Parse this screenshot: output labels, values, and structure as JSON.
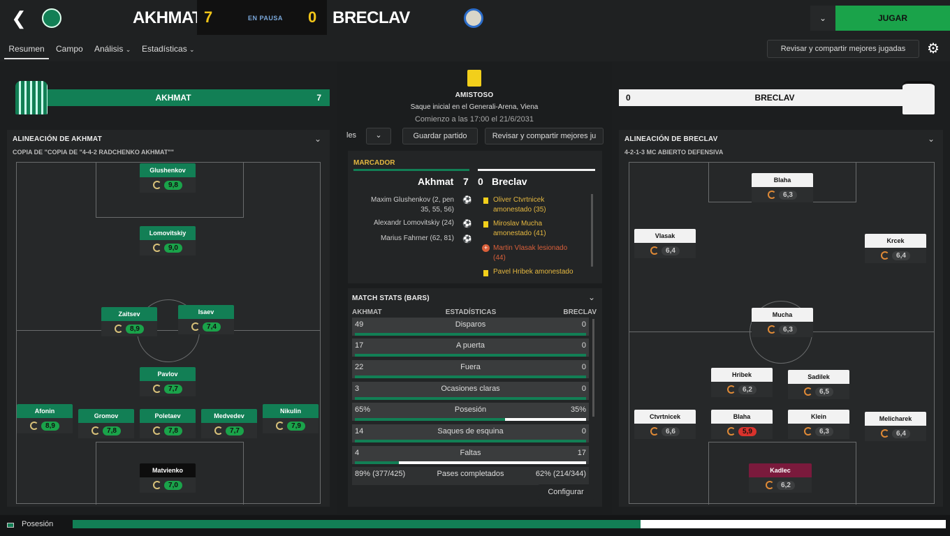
{
  "header": {
    "home_team": "AKHMAT",
    "home_score": "7",
    "status": "EN PAUSA",
    "away_score": "0",
    "away_team": "BRECLAV",
    "play_button": "JUGAR"
  },
  "nav": {
    "tabs": [
      "Resumen",
      "Campo",
      "Análisis",
      "Estadísticas"
    ],
    "review_button": "Revisar y compartir mejores jugadas"
  },
  "home_banner": {
    "name": "AKHMAT",
    "score": "7"
  },
  "away_banner": {
    "name": "BRECLAV",
    "score": "0"
  },
  "match_info": {
    "competition": "AMISTOSO",
    "kickoff": "Saque inicial en el Generali-Arena, Viena",
    "start": "Comienzo a las 17:00 el 21/6/2031"
  },
  "center_buttons": {
    "partial": "les",
    "save": "Guardar partido",
    "review": "Revisar y compartir mejores ju"
  },
  "scoreboard": {
    "title": "MARCADOR",
    "home": "Akhmat",
    "home_score": "7",
    "away_score": "0",
    "away": "Breclav",
    "home_events": [
      {
        "line1": "Maxim Glushenkov (2, pen",
        "line2": "35, 55, 56)"
      },
      {
        "line1": "Alexandr Lomovitskiy (24)",
        "line2": ""
      },
      {
        "line1": "Marius Fahrner (62, 81)",
        "line2": ""
      }
    ],
    "away_events": [
      {
        "line1": "Oliver Ctvrtnicek",
        "line2": "amonestado (35)",
        "type": "yellow"
      },
      {
        "line1": "Miroslav Mucha",
        "line2": "amonestado (41)",
        "type": "yellow"
      },
      {
        "line1": "Martin Vlasak lesionado",
        "line2": "(44)",
        "type": "injury"
      },
      {
        "line1": "Pavel Hribek amonestado",
        "line2": "",
        "type": "yellow"
      }
    ]
  },
  "stats": {
    "title": "MATCH STATS (BARS)",
    "col_home": "AKHMAT",
    "col_mid": "ESTADÍSTICAS",
    "col_away": "BRECLAV",
    "rows": [
      {
        "home": "49",
        "label": "Disparos",
        "away": "0",
        "share": 1.0
      },
      {
        "home": "17",
        "label": "A puerta",
        "away": "0",
        "share": 1.0
      },
      {
        "home": "22",
        "label": "Fuera",
        "away": "0",
        "share": 1.0
      },
      {
        "home": "3",
        "label": "Ocasiones claras",
        "away": "0",
        "share": 1.0
      },
      {
        "home": "65%",
        "label": "Posesión",
        "away": "35%",
        "share": 0.65
      },
      {
        "home": "14",
        "label": "Saques de esquina",
        "away": "0",
        "share": 1.0
      },
      {
        "home": "4",
        "label": "Faltas",
        "away": "17",
        "share": 0.19
      },
      {
        "home": "89% (377/425)",
        "label": "Pases completados",
        "away": "62% (214/344)",
        "share": null
      }
    ],
    "config_button": "Configurar"
  },
  "home_lineup": {
    "title": "ALINEACIÓN DE AKHMAT",
    "formation": "COPIA DE \"COPIA DE \"4-4-2 RADCHENKO AKHMAT\"\"",
    "players": [
      {
        "name": "Glushenkov",
        "rating": "9,8"
      },
      {
        "name": "Lomovitskiy",
        "rating": "9,0"
      },
      {
        "name": "Zaitsev",
        "rating": "8,9"
      },
      {
        "name": "Isaev",
        "rating": "7,4"
      },
      {
        "name": "Pavlov",
        "rating": "7,7"
      },
      {
        "name": "Afonin",
        "rating": "8,9"
      },
      {
        "name": "Gromov",
        "rating": "7,8"
      },
      {
        "name": "Poletaev",
        "rating": "7,8"
      },
      {
        "name": "Medvedev",
        "rating": "7,7"
      },
      {
        "name": "Nikulin",
        "rating": "7,9"
      },
      {
        "name": "Matvienko",
        "rating": "7,0"
      }
    ]
  },
  "away_lineup": {
    "title": "ALINEACIÓN DE BRECLAV",
    "formation": "4-2-1-3 MC ABIERTO DEFENSIVA",
    "players": [
      {
        "name": "Blaha",
        "rating": "6,3"
      },
      {
        "name": "Vlasak",
        "rating": "6,4"
      },
      {
        "name": "Krcek",
        "rating": "6,4"
      },
      {
        "name": "Mucha",
        "rating": "6,3"
      },
      {
        "name": "Hribek",
        "rating": "6,2"
      },
      {
        "name": "Sadilek",
        "rating": "6,5"
      },
      {
        "name": "Ctvrtnicek",
        "rating": "6,6"
      },
      {
        "name": "Blaha",
        "rating": "5,9"
      },
      {
        "name": "Klein",
        "rating": "6,3"
      },
      {
        "name": "Melicharek",
        "rating": "6,4"
      },
      {
        "name": "Kadlec",
        "rating": "6,2"
      }
    ]
  },
  "footer": {
    "label": "Posesión",
    "home_share": 0.65
  },
  "colors": {
    "accent": "#127f55",
    "play": "#1aa34a",
    "yellow": "#f0c419"
  }
}
